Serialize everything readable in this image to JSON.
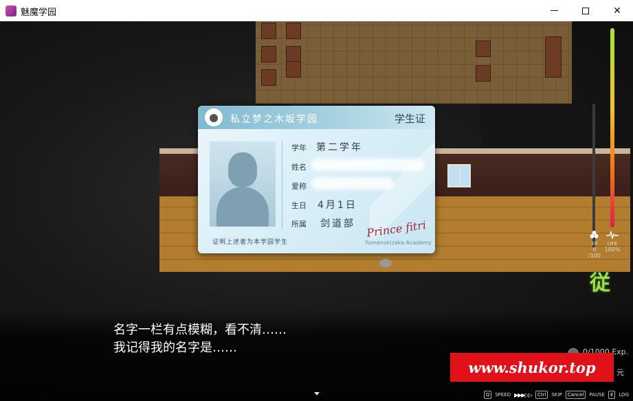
{
  "window": {
    "title": "魅魔学园",
    "minimize_glyph": "",
    "maximize_glyph": "",
    "close_glyph": "✕"
  },
  "id_card": {
    "school_name": "私立梦之木坂学园",
    "card_type": "学生证",
    "fields": [
      {
        "label": "学年",
        "value": "第二学年"
      },
      {
        "label": "姓名",
        "value": ""
      },
      {
        "label": "爱称",
        "value": ""
      },
      {
        "label": "生日",
        "value": "4月1日"
      },
      {
        "label": "所属",
        "value": "剑道部"
      }
    ],
    "footer": "证明上述者为本学园学生",
    "signature": "Prince fitri",
    "academy_caption": "Yumenokizaka Academy"
  },
  "hud": {
    "ep_label": "EP",
    "ep_value": "0",
    "ep_max": "/100",
    "life_label": "LIFE",
    "life_value": "100%",
    "life_level": 1.0,
    "state_glyph": "従",
    "exp_text": "0/1000 Exp.",
    "money_unit": "元",
    "colors": {
      "state": "#9be04b",
      "life_top": "#a7e33a",
      "life_bottom": "#e11d48"
    }
  },
  "dialogue": {
    "lines": [
      "名字一栏有点模糊，看不清……",
      "我记得我的名字是……"
    ]
  },
  "watermark": "www.shukor.top",
  "controls": [
    {
      "key": "Q",
      "label": "SPEED"
    },
    {
      "key": "Ctrl",
      "label": "SKIP"
    },
    {
      "key": "Cancel",
      "label": "PAUSE"
    },
    {
      "key": "E",
      "label": "LOG"
    }
  ],
  "icons": [
    "app-icon",
    "sheep-logo-icon",
    "ep-drop-icon",
    "heartbeat-icon",
    "exp-coin-icon",
    "continue-arrow-icon"
  ]
}
